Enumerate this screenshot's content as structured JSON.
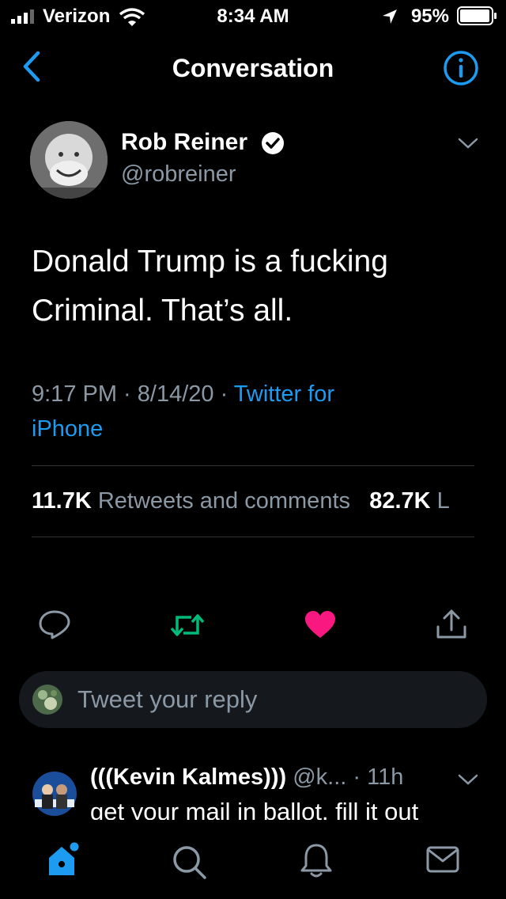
{
  "status": {
    "carrier": "Verizon",
    "time": "8:34 AM",
    "battery": "95%"
  },
  "nav": {
    "title": "Conversation"
  },
  "tweet": {
    "author_name": "Rob Reiner",
    "author_handle": "@robreiner",
    "text_line1": "Donald Trump is a fucking",
    "text_line2": "Criminal. That’s all.",
    "time_date": "9:17 PM · 8/14/20 · ",
    "source": "Twitter for",
    "source2": "iPhone",
    "retweets_count": "11.7K",
    "retweets_label": "Retweets and comments",
    "likes_count": "82.7K",
    "likes_label_partial": "L"
  },
  "reply_box": {
    "placeholder": "Tweet your reply"
  },
  "reply": {
    "name": "(((Kevin Kalmes)))",
    "handle_time": "@k... · 11h",
    "text": "get your mail in ballot, fill it out"
  },
  "colors": {
    "accent": "#1d9bf0",
    "like": "#f91880",
    "retweet": "#00ba7c",
    "secondary_text": "#8b98a5"
  }
}
